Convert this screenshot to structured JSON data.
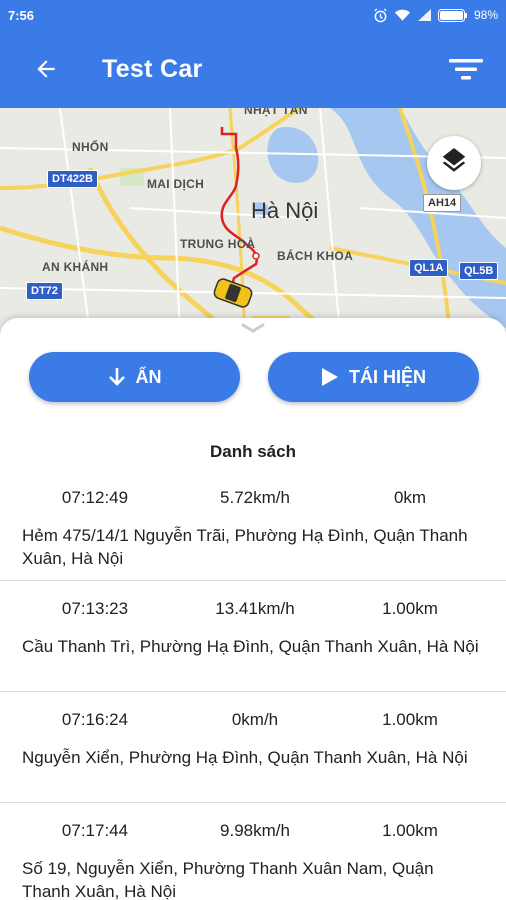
{
  "status_bar": {
    "time": "7:56",
    "battery": "98%"
  },
  "app_bar": {
    "title": "Test Car",
    "back_icon": "arrow-left-icon",
    "filter_icon": "filter-icon"
  },
  "map": {
    "city": "Hà Nội",
    "labels": {
      "nhat_tan": "NHẬT TÂN",
      "nhon": "NHỔN",
      "mai_dich": "MAI DỊCH",
      "trung_hoa": "TRUNG HOÀ",
      "bach_khoa": "BÁCH KHOA",
      "an_khanh": "AN KHÁNH"
    },
    "shields": {
      "dt422b": "DT422B",
      "dt72": "DT72",
      "ah14": "AH14",
      "ql1a": "QL1A",
      "ql5b": "QL5B"
    },
    "layers_icon": "layers-icon",
    "route_color": "#e02020"
  },
  "actions": {
    "hide_label": "ẨN",
    "replay_label": "TÁI HIỆN"
  },
  "list": {
    "title": "Danh sách",
    "rows": [
      {
        "time": "07:12:49",
        "speed": "5.72km/h",
        "distance": "0km",
        "address": "Hẻm 475/14/1 Nguyễn Trãi, Phường Hạ Đình, Quận Thanh Xuân, Hà Nội"
      },
      {
        "time": "07:13:23",
        "speed": "13.41km/h",
        "distance": "1.00km",
        "address": "Cầu Thanh Trì, Phường Hạ Đình, Quận Thanh Xuân, Hà Nội"
      },
      {
        "time": "07:16:24",
        "speed": "0km/h",
        "distance": "1.00km",
        "address": "Nguyễn Xiển, Phường Hạ Đình, Quận Thanh Xuân, Hà Nội"
      },
      {
        "time": "07:17:44",
        "speed": "9.98km/h",
        "distance": "1.00km",
        "address": "Số 19, Nguyễn Xiển, Phường Thanh Xuân Nam, Quận Thanh Xuân, Hà Nội"
      }
    ]
  },
  "colors": {
    "primary": "#3a7be8"
  }
}
